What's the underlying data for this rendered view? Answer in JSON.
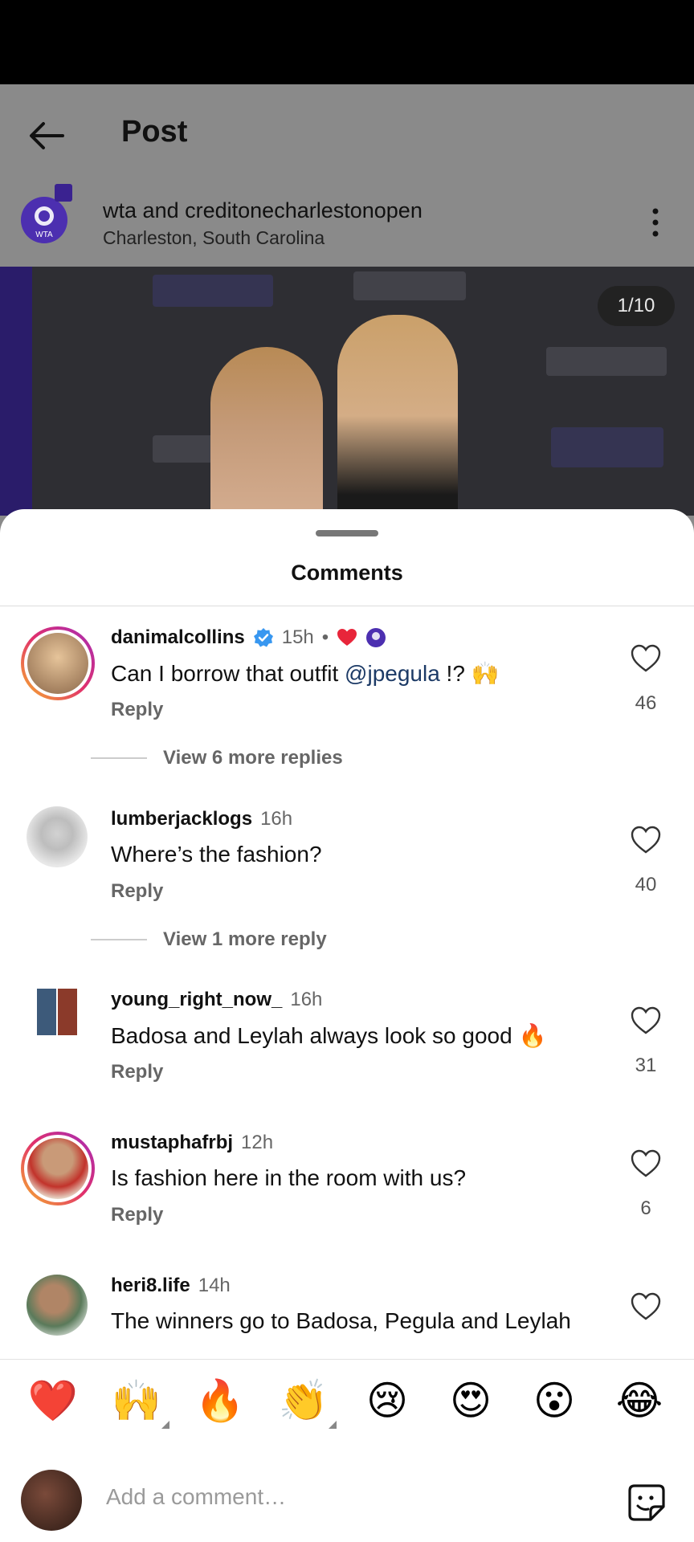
{
  "header": {
    "title": "Post"
  },
  "post": {
    "author_primary": "wta",
    "author_joiner": "and",
    "author_secondary": "creditonecharlestonopen",
    "location": "Charleston, South Carolina",
    "image_counter": "1/10",
    "avatar_text": "WTA"
  },
  "sheet": {
    "title": "Comments"
  },
  "comments": [
    {
      "user": "danimalcollins",
      "verified": true,
      "time": "15h",
      "separator": "•",
      "text_before": "Can I borrow that outfit ",
      "mention": "@jpegula",
      "text_after": " !? 🙌",
      "reply": "Reply",
      "likes": "46",
      "view_more": "View 6 more replies"
    },
    {
      "user": "lumberjacklogs",
      "time": "16h",
      "text": "Where’s the fashion?",
      "reply": "Reply",
      "likes": "40",
      "view_more": "View 1 more reply"
    },
    {
      "user": "young_right_now_",
      "time": "16h",
      "text": "Badosa and Leylah always look so good 🔥",
      "reply": "Reply",
      "likes": "31"
    },
    {
      "user": "mustaphafrbj",
      "time": "12h",
      "text": "Is fashion here in the room with us?",
      "reply": "Reply",
      "likes": "6"
    },
    {
      "user": "heri8.life",
      "time": "14h",
      "text": "The winners go to Badosa, Pegula and Leylah"
    }
  ],
  "reactions": [
    "❤️",
    "🙌",
    "🔥",
    "👏",
    "😢",
    "😍",
    "😮",
    "😂"
  ],
  "compose": {
    "placeholder": "Add a comment…"
  },
  "colors": {
    "heart_red": "#e8253a",
    "mention_blue": "#1c3a66",
    "verified_blue": "#3897f0",
    "wta_purple": "#4c2fb0"
  }
}
